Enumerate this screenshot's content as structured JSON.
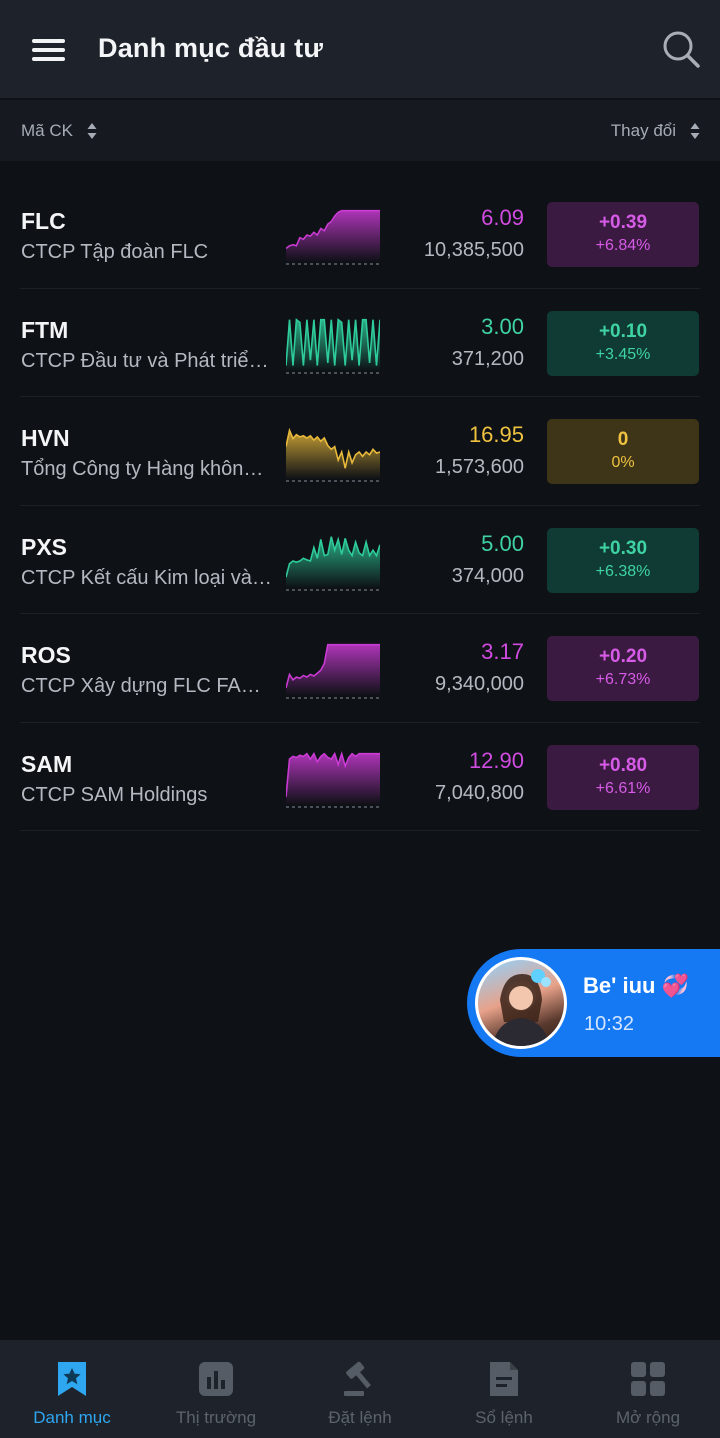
{
  "header": {
    "title": "Danh mục đầu tư",
    "menu_icon": "hamburger-menu-icon",
    "search_icon": "search-icon"
  },
  "sortbar": {
    "left_label": "Mã CK",
    "right_label": "Thay đổi"
  },
  "colors": {
    "background": "#0e1116",
    "header": "#1e232b",
    "up_strong": "#c93bd3",
    "up": "#2ecc9a",
    "flat": "#e8b93a",
    "accent": "#2ea6f0"
  },
  "stocks": [
    {
      "symbol": "FLC",
      "name": "CTCP Tập đoàn FLC",
      "price": "6.09",
      "volume": "10,385,500",
      "change": "+0.39",
      "percent": "+6.84%",
      "status": "ceiling",
      "trend": [
        0.25,
        0.3,
        0.32,
        0.3,
        0.45,
        0.42,
        0.5,
        0.48,
        0.55,
        0.5,
        0.62,
        0.58,
        0.7,
        0.75,
        0.85,
        0.92,
        0.95,
        0.95,
        0.95,
        0.95,
        0.95,
        0.95,
        0.95,
        0.95,
        0.95,
        0.95,
        0.95,
        0.95
      ]
    },
    {
      "symbol": "FTM",
      "name": "CTCP Đầu tư và Phát triển Sản xuất Hàng Tiêu dùng",
      "price": "3.00",
      "volume": "371,200",
      "change": "+0.10",
      "percent": "+3.45%",
      "status": "up",
      "trend": [
        0.1,
        0.95,
        0.1,
        0.95,
        0.9,
        0.1,
        0.95,
        0.2,
        0.95,
        0.1,
        0.95,
        0.95,
        0.15,
        0.95,
        0.1,
        0.95,
        0.9,
        0.1,
        0.95,
        0.2,
        0.95,
        0.1,
        0.95,
        0.95,
        0.15,
        0.95,
        0.1,
        0.95
      ]
    },
    {
      "symbol": "HVN",
      "name": "Tổng Công ty Hàng không Việt Nam",
      "price": "16.95",
      "volume": "1,573,600",
      "change": "0",
      "percent": "0%",
      "status": "flat",
      "trend": [
        0.6,
        0.9,
        0.75,
        0.82,
        0.78,
        0.8,
        0.76,
        0.8,
        0.72,
        0.78,
        0.7,
        0.76,
        0.62,
        0.55,
        0.6,
        0.35,
        0.5,
        0.2,
        0.5,
        0.3,
        0.45,
        0.5,
        0.42,
        0.5,
        0.45,
        0.55,
        0.48,
        0.5
      ]
    },
    {
      "symbol": "PXS",
      "name": "CTCP Kết cấu Kim loại và Lắp máy Dầu khí",
      "price": "5.00",
      "volume": "374,000",
      "change": "+0.30",
      "percent": "+6.38%",
      "status": "up",
      "trend": [
        0.2,
        0.45,
        0.5,
        0.48,
        0.5,
        0.55,
        0.52,
        0.5,
        0.75,
        0.55,
        0.9,
        0.6,
        0.62,
        0.95,
        0.7,
        0.9,
        0.62,
        0.92,
        0.7,
        0.6,
        0.85,
        0.65,
        0.6,
        0.85,
        0.6,
        0.7,
        0.6,
        0.8
      ]
    },
    {
      "symbol": "ROS",
      "name": "CTCP Xây dựng FLC FAROS",
      "price": "3.17",
      "volume": "9,340,000",
      "change": "+0.20",
      "percent": "+6.73%",
      "status": "ceiling",
      "trend": [
        0.15,
        0.4,
        0.3,
        0.35,
        0.33,
        0.38,
        0.35,
        0.4,
        0.37,
        0.42,
        0.48,
        0.6,
        0.95,
        0.95,
        0.95,
        0.95,
        0.95,
        0.95,
        0.95,
        0.95,
        0.95,
        0.95,
        0.95,
        0.95,
        0.95,
        0.95,
        0.95,
        0.95
      ]
    },
    {
      "symbol": "SAM",
      "name": "CTCP SAM Holdings",
      "price": "12.90",
      "volume": "7,040,800",
      "change": "+0.80",
      "percent": "+6.61%",
      "status": "ceiling",
      "trend": [
        0.15,
        0.85,
        0.9,
        0.88,
        0.92,
        0.9,
        0.95,
        0.85,
        0.95,
        0.8,
        0.9,
        0.95,
        0.88,
        0.85,
        0.95,
        0.75,
        0.95,
        0.72,
        0.88,
        0.95,
        0.9,
        0.95,
        0.95,
        0.95,
        0.95,
        0.95,
        0.95,
        0.95
      ]
    }
  ],
  "chat_head": {
    "name": "Be' iuu 💞",
    "time": "10:32"
  },
  "bottom_nav": [
    {
      "label": "Danh mục",
      "icon": "bookmark-star-icon",
      "active": true
    },
    {
      "label": "Thị trường",
      "icon": "bar-chart-icon",
      "active": false
    },
    {
      "label": "Đặt lệnh",
      "icon": "gavel-icon",
      "active": false
    },
    {
      "label": "Sổ lệnh",
      "icon": "document-icon",
      "active": false
    },
    {
      "label": "Mở rộng",
      "icon": "grid-icon",
      "active": false
    }
  ]
}
